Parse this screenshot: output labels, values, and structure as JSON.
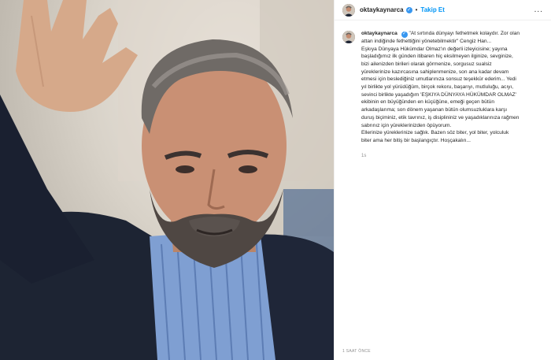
{
  "post": {
    "username": "oktaykaynarca",
    "verified_icon": "verified-badge-icon",
    "follow_label": "Takip Et",
    "separator": "•",
    "more_label": "...",
    "caption_username": "oktaykaynarca",
    "caption_lines": [
      "\"At sırtında dünyayı fethetmek kolaydır. Zor olan",
      "attan indiğinde fethettiğini yönetebilmektir\" Cengiz Han...",
      "Eşkıya Dünyaya Hükümdar Olmaz'ın değerli izleyicisine; yayına",
      "başladığımız ilk günden itibaren hiç eksilmeyen ilginize, sevginize,",
      "bizi ailenizden birileri olarak görmenize, sorgusuz sualsiz",
      "yüreklerinize kazırcasına sahiplenmenize, son ana kadar devam",
      "etmesi için beslediğiniz umutlarınıza sonsuz teşekkür ederim... Yedi",
      "yıl birlikte yol yürüdüğüm, birçok rekoru, başarıyı, mutluluğu, acıyı,",
      "sevinci birlikte yaşadığım 'EŞKIYA DÜNYAYA HÜKÜMDAR OLMAZ'",
      "ekibinin en büyüğünden en küçüğüne, emeği geçen bütün",
      "arkadaşlarıma; son dönem yaşanan bütün olumsuzluklara karşı",
      "duruş biçiminiz, etik tavrınız, iş disiplininiz ve yaşadıklarınıza rağmen",
      "sabrınız için yüreklerinizden öpüyorum.",
      "Ellerinize yüreklerinize sağlık. Bazen söz biter, yol biter, yolculuk",
      "biter ama her bitiş bir başlangıçtır. Hoşçakalın..."
    ],
    "caption_time": "1s",
    "post_time": "1 SAAT ÖNCE"
  }
}
